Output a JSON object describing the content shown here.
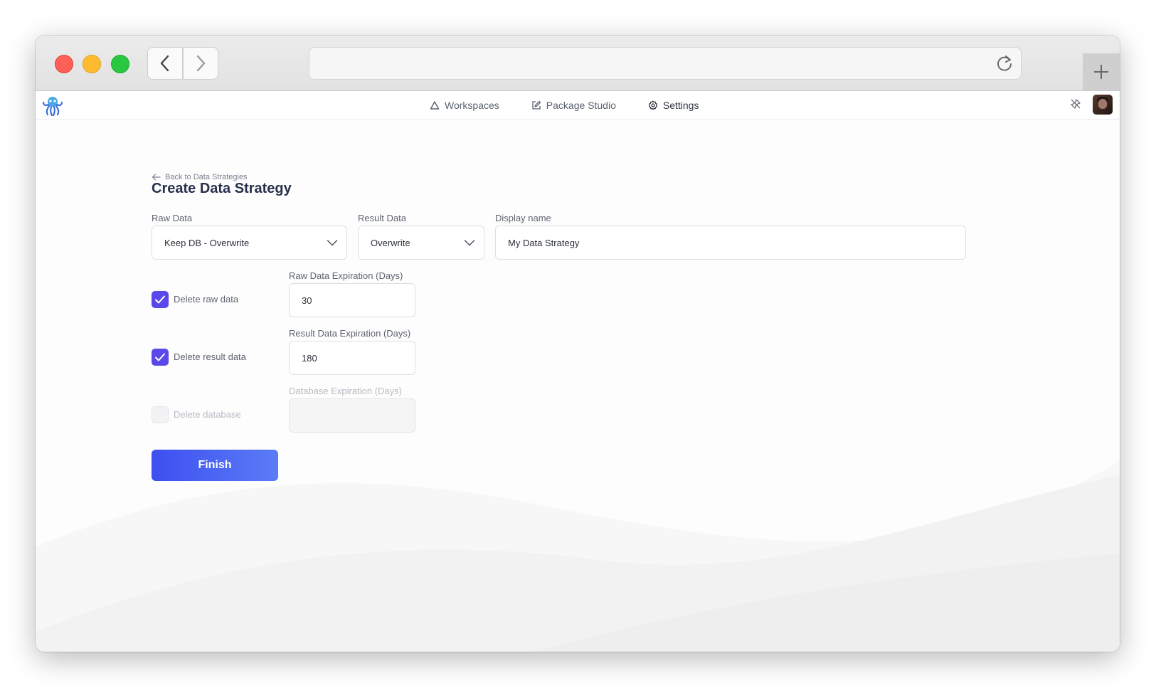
{
  "nav": {
    "items": [
      {
        "label": "Workspaces",
        "icon": "triangle-icon"
      },
      {
        "label": "Package Studio",
        "icon": "edit-icon"
      },
      {
        "label": "Settings",
        "icon": "gear-icon"
      }
    ]
  },
  "page": {
    "back_label": "Back to Data Strategies",
    "title": "Create Data Strategy"
  },
  "form": {
    "raw_data": {
      "label": "Raw Data",
      "value": "Keep DB - Overwrite"
    },
    "result_data": {
      "label": "Result Data",
      "value": "Overwrite"
    },
    "display_name": {
      "label": "Display name",
      "value": "My Data Strategy"
    },
    "delete_raw": {
      "label": "Delete raw data",
      "checked": true
    },
    "raw_expiration": {
      "label": "Raw Data Expiration (Days)",
      "value": "30"
    },
    "delete_result": {
      "label": "Delete result data",
      "checked": true
    },
    "result_expiration": {
      "label": "Result Data Expiration (Days)",
      "value": "180"
    },
    "delete_database": {
      "label": "Delete database",
      "checked": false,
      "disabled": true
    },
    "database_expiration": {
      "label": "Database Expiration (Days)",
      "value": ""
    },
    "finish_label": "Finish"
  },
  "colors": {
    "accent": "#5b48ea",
    "button_start": "#3d4ff0",
    "button_end": "#5b7cf6",
    "title": "#27304a"
  }
}
